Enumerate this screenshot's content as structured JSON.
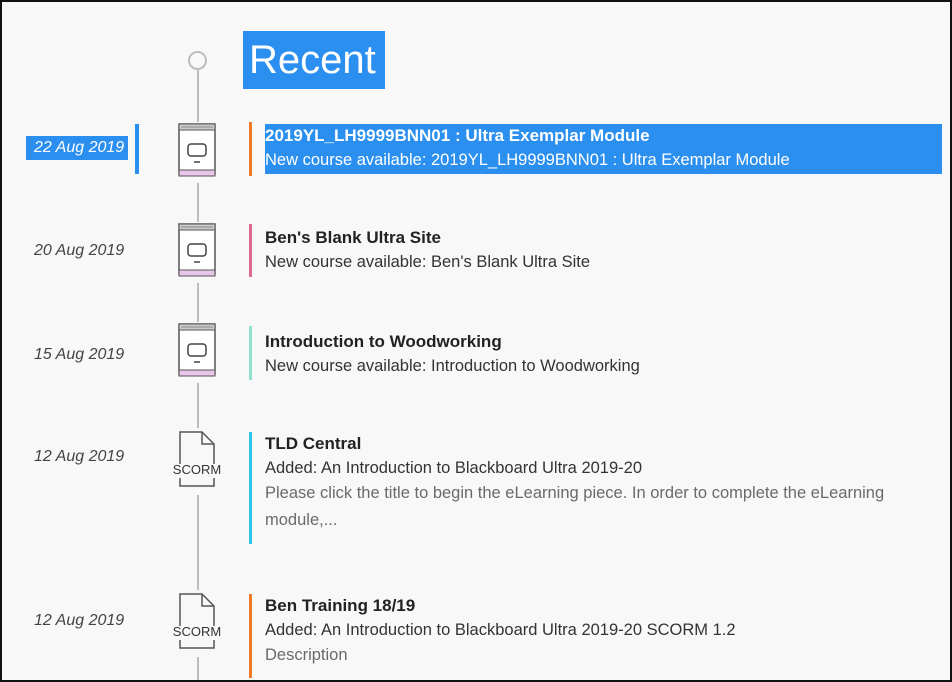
{
  "page": {
    "heading": "Recent"
  },
  "colors": {
    "selection": "#2b8fef",
    "timeline": "#bdbdbd",
    "accent_orange": "#f07a2b",
    "accent_pink": "#e0688e",
    "accent_mint": "#8fe0cf",
    "accent_cyan": "#2ec4e8"
  },
  "entries": [
    {
      "date": "22 Aug 2019",
      "icon": "course-book-icon",
      "title": "2019YL_LH9999BNN01 : Ultra Exemplar Module",
      "line": "New course available: 2019YL_LH9999BNN01 : Ultra Exemplar Module",
      "accent": "#f07a2b"
    },
    {
      "date": "20 Aug 2019",
      "icon": "course-book-icon",
      "title": "Ben's Blank Ultra Site",
      "line": "New course available: Ben's Blank Ultra Site",
      "accent": "#e0688e"
    },
    {
      "date": "15 Aug 2019",
      "icon": "course-book-icon",
      "title": "Introduction to Woodworking",
      "line": "New course available: Introduction to Woodworking",
      "accent": "#8fe0cf"
    },
    {
      "date": "12 Aug 2019",
      "icon": "scorm-document-icon",
      "icon_label": "SCORM",
      "title": "TLD Central",
      "line": "Added: An Introduction to Blackboard Ultra 2019-20",
      "description": "Please click the title to begin the eLearning piece.  In order to complete the eLearning module,...",
      "accent": "#2ec4e8"
    },
    {
      "date": "12 Aug 2019",
      "icon": "scorm-document-icon",
      "icon_label": "SCORM",
      "title": "Ben Training 18/19",
      "line": "Added: An Introduction to Blackboard Ultra 2019-20 SCORM 1.2",
      "description": "Description",
      "accent": "#f07a2b"
    }
  ]
}
